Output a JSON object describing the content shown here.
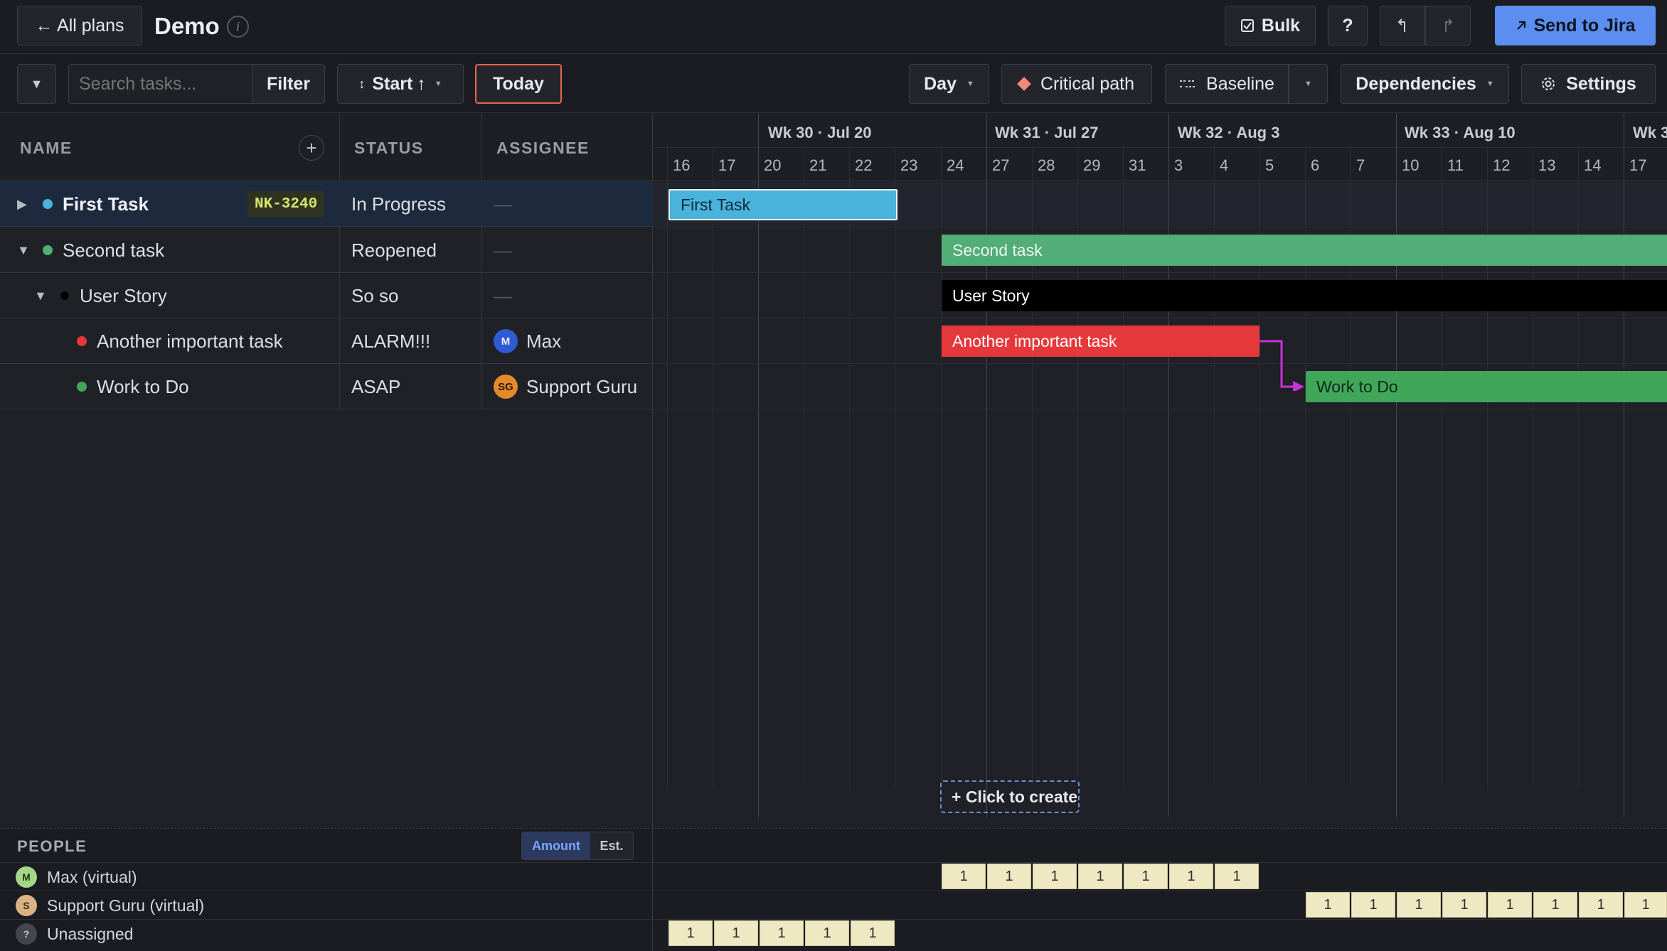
{
  "header": {
    "back_label": "← All plans",
    "title": "Demo",
    "info_glyph": "i",
    "bulk_label": "Bulk",
    "help_label": "?",
    "send_label": "Send to Jira"
  },
  "toolbar": {
    "collapse_glyph": "▼",
    "search_placeholder": "Search tasks...",
    "filter_label": "Filter",
    "sort_label": "Start",
    "today_label": "Today",
    "scale_label": "Day",
    "critical_label": "Critical path",
    "baseline_label": "Baseline",
    "dependencies_label": "Dependencies",
    "settings_label": "Settings"
  },
  "columns": {
    "name": "NAME",
    "status": "STATUS",
    "assignee": "ASSIGNEE"
  },
  "tasks": [
    {
      "name": "First Task",
      "key": "NK-3240",
      "status": "In Progress",
      "assignee": "—",
      "color": "#4ab3dc",
      "selected": true
    },
    {
      "name": "Second task",
      "status": "Reopened",
      "assignee": "—",
      "color": "#52ad76"
    },
    {
      "name": "User Story",
      "status": "So so",
      "assignee": "—",
      "color": "#000000"
    },
    {
      "name": "Another important task",
      "status": "ALARM!!!",
      "assignee": "Max",
      "assignee_initials": "M",
      "color": "#e5383b"
    },
    {
      "name": "Work to Do",
      "status": "ASAP",
      "assignee": "Support Guru",
      "assignee_initials": "SG",
      "color": "#40a65a"
    }
  ],
  "timeline": {
    "weeks": [
      "Wk 30 · Jul 20",
      "Wk 31 · Jul 27",
      "Wk 32 · Aug 3",
      "Wk 33 · Aug 10",
      "Wk 3"
    ],
    "days": [
      "16",
      "17",
      "20",
      "21",
      "22",
      "23",
      "24",
      "27",
      "28",
      "29",
      "31",
      "3",
      "4",
      "5",
      "6",
      "7",
      "10",
      "11",
      "12",
      "13",
      "14",
      "17"
    ],
    "bars": [
      "First Task",
      "Second task",
      "User Story",
      "Another important task",
      "Work to Do"
    ],
    "create_label": "+ Click to create"
  },
  "people": {
    "header": "PEOPLE",
    "toggle": [
      "Amount",
      "Est."
    ],
    "rows": [
      {
        "name": "Max (virtual)",
        "initial": "M",
        "loads": [
          "1",
          "1",
          "1",
          "1",
          "1",
          "1",
          "1"
        ]
      },
      {
        "name": "Support Guru (virtual)",
        "initial": "S",
        "loads": [
          "1",
          "1",
          "1",
          "1",
          "1",
          "1",
          "1",
          "1"
        ]
      },
      {
        "name": "Unassigned",
        "initial": "?",
        "loads": [
          "1",
          "1",
          "1",
          "1",
          "1"
        ]
      }
    ]
  },
  "colors": {
    "accent": "#5b8ef0",
    "today_border": "#e4674f",
    "dependency_arrow": "#c832d8"
  }
}
